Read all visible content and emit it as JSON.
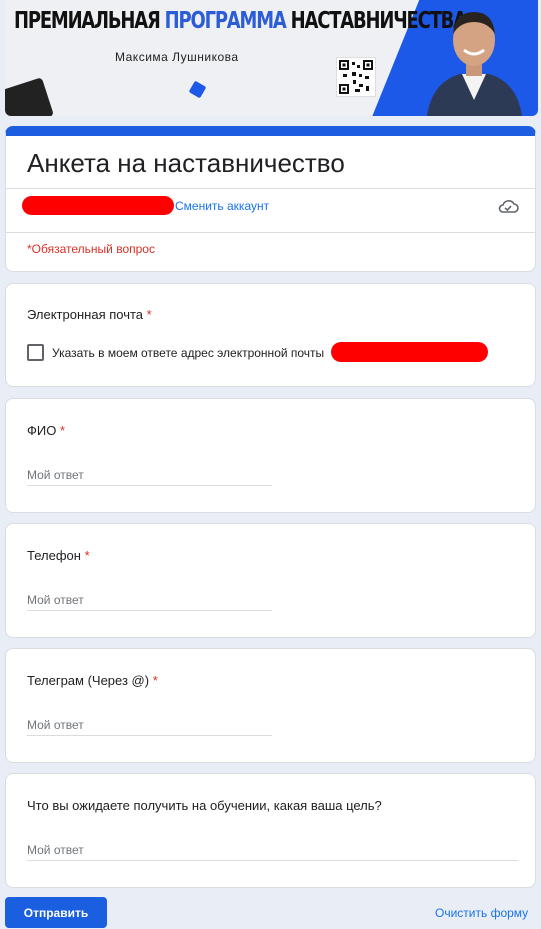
{
  "banner": {
    "title_part1": "ПРЕМИАЛЬНАЯ ",
    "title_accent": "ПРОГРАММА",
    "title_part2": " НАСТАВНИЧЕСТВА",
    "subtitle": "Максима Лушникова",
    "brand_color": "#1d59e8"
  },
  "form": {
    "title": "Анкета на наставничество",
    "switch_account": "Сменить аккаунт",
    "required_note": "*Обязательный вопрос",
    "accent_color": "#1d5ee0"
  },
  "questions": [
    {
      "label": "Электронная почта",
      "required": "*",
      "checkbox_label": "Указать в моем ответе адрес электронной почты"
    },
    {
      "label": "ФИО",
      "required": "*",
      "placeholder": "Мой ответ"
    },
    {
      "label": "Телефон",
      "required": "*",
      "placeholder": "Мой ответ"
    },
    {
      "label": "Телеграм (Через @)",
      "required": "*",
      "placeholder": "Мой ответ"
    },
    {
      "label": "Что вы ожидаете получить на обучении, какая ваша цель?",
      "placeholder": "Мой ответ"
    }
  ],
  "actions": {
    "submit": "Отправить",
    "clear": "Очистить форму"
  },
  "icons": [
    "cloud-check-icon",
    "checkbox-icon",
    "qr-code-icon"
  ]
}
